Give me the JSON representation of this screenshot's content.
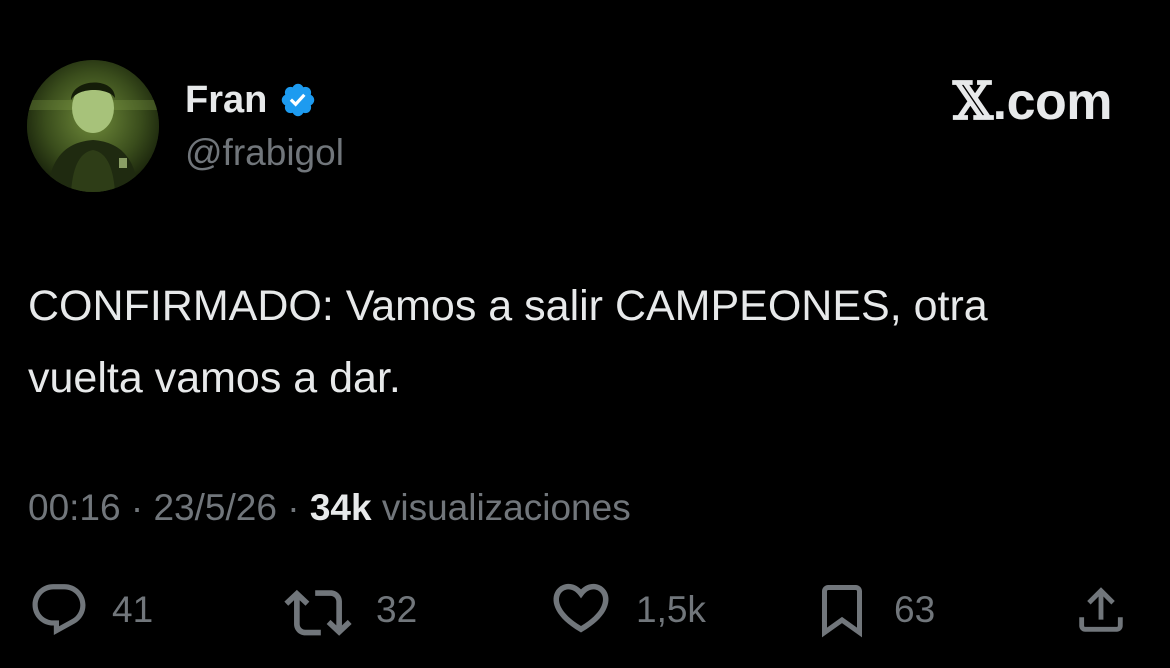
{
  "author": {
    "display_name": "Fran",
    "handle": "@frabigol",
    "verified": true,
    "verified_color": "#1d9bf0"
  },
  "brand": {
    "glyph": "𝕏",
    "suffix": ".com"
  },
  "tweet": {
    "text": "CONFIRMADO: Vamos a salir CAMPEONES, otra\nvuelta vamos a dar."
  },
  "meta": {
    "time": "00:16",
    "separator": "·",
    "date": "23/5/26",
    "views_count": "34k",
    "views_label": "visualizaciones"
  },
  "actions": {
    "reply": {
      "icon": "reply-icon",
      "count": "41"
    },
    "repost": {
      "icon": "repost-icon",
      "count": "32"
    },
    "like": {
      "icon": "like-icon",
      "count": "1,5k"
    },
    "bookmark": {
      "icon": "bookmark-icon",
      "count": "63"
    },
    "share": {
      "icon": "share-icon"
    }
  },
  "colors": {
    "background": "#000000",
    "primary_text": "#e7e9ea",
    "secondary_text": "#71767b"
  }
}
